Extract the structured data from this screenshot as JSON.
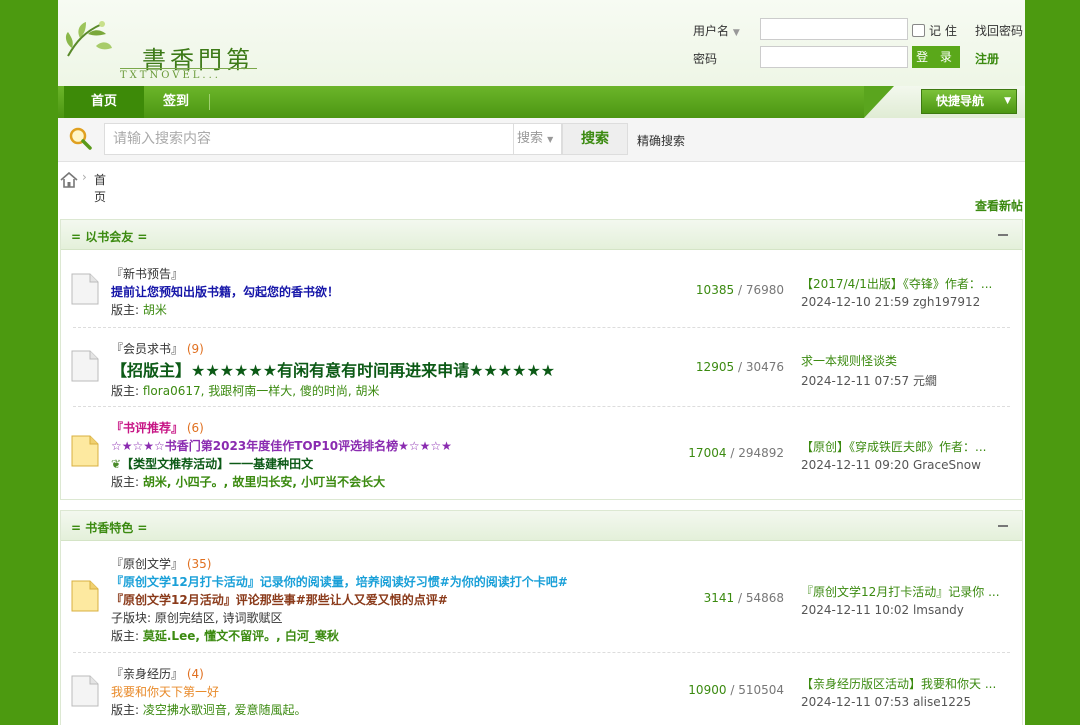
{
  "header": {
    "logo_cn": "書香門第",
    "logo_en": "TXTNOVEL...",
    "username_label": "用户名",
    "password_label": "密码",
    "remember_label": "记 住",
    "forgot_label": "找回密码",
    "login_label": "登 录",
    "register_label": "注册"
  },
  "nav": {
    "items": [
      {
        "label": "首页"
      },
      {
        "label": "签到"
      }
    ],
    "quick_nav": "快捷导航"
  },
  "search": {
    "placeholder": "请输入搜索内容",
    "type": "搜索",
    "button": "搜索",
    "advanced": "精确搜索"
  },
  "breadcrumb": {
    "current": "首页"
  },
  "view_new": "查看新帖",
  "boards": [
    {
      "title": "= 以书会友 =",
      "forums": [
        {
          "name": "『新书预告』",
          "count": "",
          "lines": [
            {
              "text": "提前让您预知出版书籍，勾起您的香书欲！",
              "color": "#1515a8"
            }
          ],
          "sub": "",
          "mod_label": "版主:",
          "moderators": "胡米",
          "threads": "10385",
          "posts": "76980",
          "last_title": "【2017/4/1出版】《夺锋》作者：...",
          "last_meta": "2024-12-10 21:59 zgh197912"
        },
        {
          "name": "『会员求书』",
          "count": "(9)",
          "lines": [
            {
              "text": "【招版主】★★★★★★有闲有意有时间再进来申请★★★★★★",
              "color": "#0c5a16"
            }
          ],
          "sub": "",
          "mod_label": "版主:",
          "moderators": "flora0617, 我跟柯南一样大, 傻的时尚, 胡米",
          "threads": "12905",
          "posts": "30476",
          "last_title": "求一本规则怪谈类",
          "last_meta": "2024-12-11 07:57 元繝"
        },
        {
          "name": "『书评推荐』",
          "count": "(6)",
          "lines": [
            {
              "text": "☆★☆★☆书香门第2023年度佳作TOP10评选排名榜★☆★☆★",
              "color": "#8a2bb0"
            },
            {
              "text": "【类型文推荐活动】一一基建种田文",
              "color": "#0c5a16"
            }
          ],
          "sub": "",
          "mod_label": "版主:",
          "moderators": "胡米, 小四子。, 故里归长安, 小叮当不会长大",
          "threads": "17004",
          "posts": "294892",
          "last_title": "【原创】《穿成铁匠夫郎》作者：...",
          "last_meta": "2024-12-11 09:20 GraceSnow"
        }
      ]
    },
    {
      "title": "= 书香特色 =",
      "forums": [
        {
          "name": "『原创文学』",
          "count": "(35)",
          "lines": [
            {
              "text": "『原创文学12月打卡活动』记录你的阅读量，培养阅读好习惯#为你的阅读打个卡吧#",
              "color": "#1aa0d8"
            },
            {
              "text": "『原创文学12月活动』评论那些事#那些让人又爱又恨的点评#",
              "color": "#8a3a1a"
            }
          ],
          "sub": "子版块: 原创完结区, 诗词歌赋区",
          "mod_label": "版主:",
          "moderators": "莫延.Lee, 懂文不留评。, 白河_寒秋",
          "threads": "3141",
          "posts": "54868",
          "last_title": "『原创文学12月打卡活动』记录你 ...",
          "last_meta": "2024-12-11 10:02 lmsandy"
        },
        {
          "name": "『亲身经历』",
          "count": "(4)",
          "lines": [
            {
              "text": "我要和你天下第一好",
              "color": "#e88a2a"
            }
          ],
          "sub": "",
          "mod_label": "版主:",
          "moderators": "凌空拂水歌迥音, 爱意随風起。",
          "threads": "10900",
          "posts": "510504",
          "last_title": "【亲身经历版区活动】我要和你天 ...",
          "last_meta": "2024-12-11 07:53 alise1225"
        }
      ]
    }
  ]
}
